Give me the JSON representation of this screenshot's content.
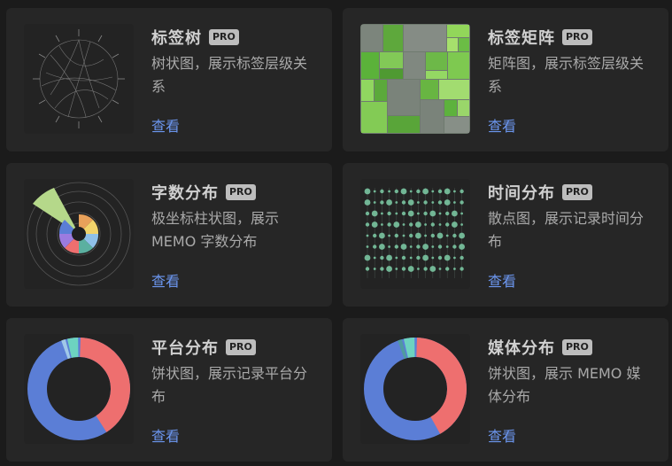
{
  "pro_badge": "PRO",
  "view_label": "查看",
  "cards": [
    {
      "title": "标签树",
      "desc": "树状图，展示标签层级关系",
      "icon": "radial-tree-icon"
    },
    {
      "title": "标签矩阵",
      "desc": "矩阵图，展示标签层级关系",
      "icon": "treemap-icon"
    },
    {
      "title": "字数分布",
      "desc": "极坐标柱状图，展示 MEMO 字数分布",
      "icon": "polar-bar-icon"
    },
    {
      "title": "时间分布",
      "desc": "散点图，展示记录时间分布",
      "icon": "scatter-icon"
    },
    {
      "title": "平台分布",
      "desc": "饼状图，展示记录平台分布",
      "icon": "donut-icon"
    },
    {
      "title": "媒体分布",
      "desc": "饼状图，展示 MEMO 媒体分布",
      "icon": "donut-icon"
    }
  ],
  "colors": {
    "accent_link": "#6c97f0",
    "card_bg": "#262626",
    "page_bg": "#1b1b1b",
    "donut_red": "#ee6f6f",
    "donut_blue": "#5b7ed6",
    "donut_teal": "#6dd3c0",
    "treemap_green": "#77c14d"
  }
}
